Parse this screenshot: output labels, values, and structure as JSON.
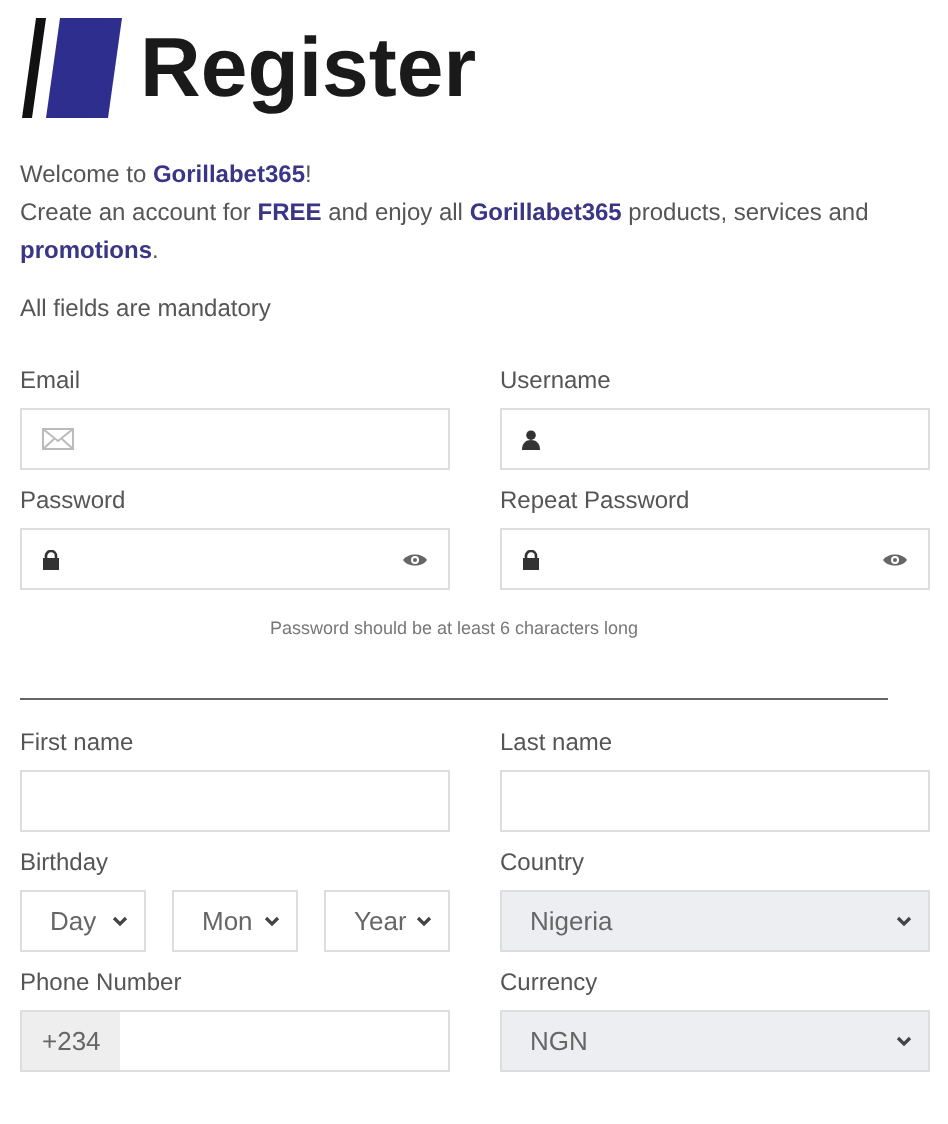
{
  "title": "Register",
  "intro": [
    "Welcome to **Gorillabet365**!",
    "Create an account for **FREE** and enjoy all **Gorillabet365** products, services and **promotions**."
  ],
  "mandatory_note": "All fields are mandatory",
  "account_rows": [
    [
      {
        "kind": "email",
        "label": "Email"
      },
      {
        "kind": "username",
        "label": "Username"
      }
    ],
    [
      {
        "kind": "password",
        "label": "Password"
      },
      {
        "kind": "password",
        "label": "Repeat Password"
      }
    ]
  ],
  "password_hint": "Password should be at least 6 characters long",
  "personal_rows": [
    [
      {
        "kind": "text",
        "label": "First name"
      },
      {
        "kind": "text",
        "label": "Last name"
      }
    ],
    [
      {
        "kind": "date",
        "label": "Birthday",
        "parts": [
          "Day",
          "Mon",
          "Year"
        ]
      },
      {
        "kind": "select",
        "label": "Country",
        "value": "Nigeria",
        "disabled": true
      }
    ],
    [
      {
        "kind": "phone",
        "label": "Phone Number",
        "prefix": "+234"
      },
      {
        "kind": "select",
        "label": "Currency",
        "value": "NGN",
        "disabled": true
      }
    ]
  ]
}
